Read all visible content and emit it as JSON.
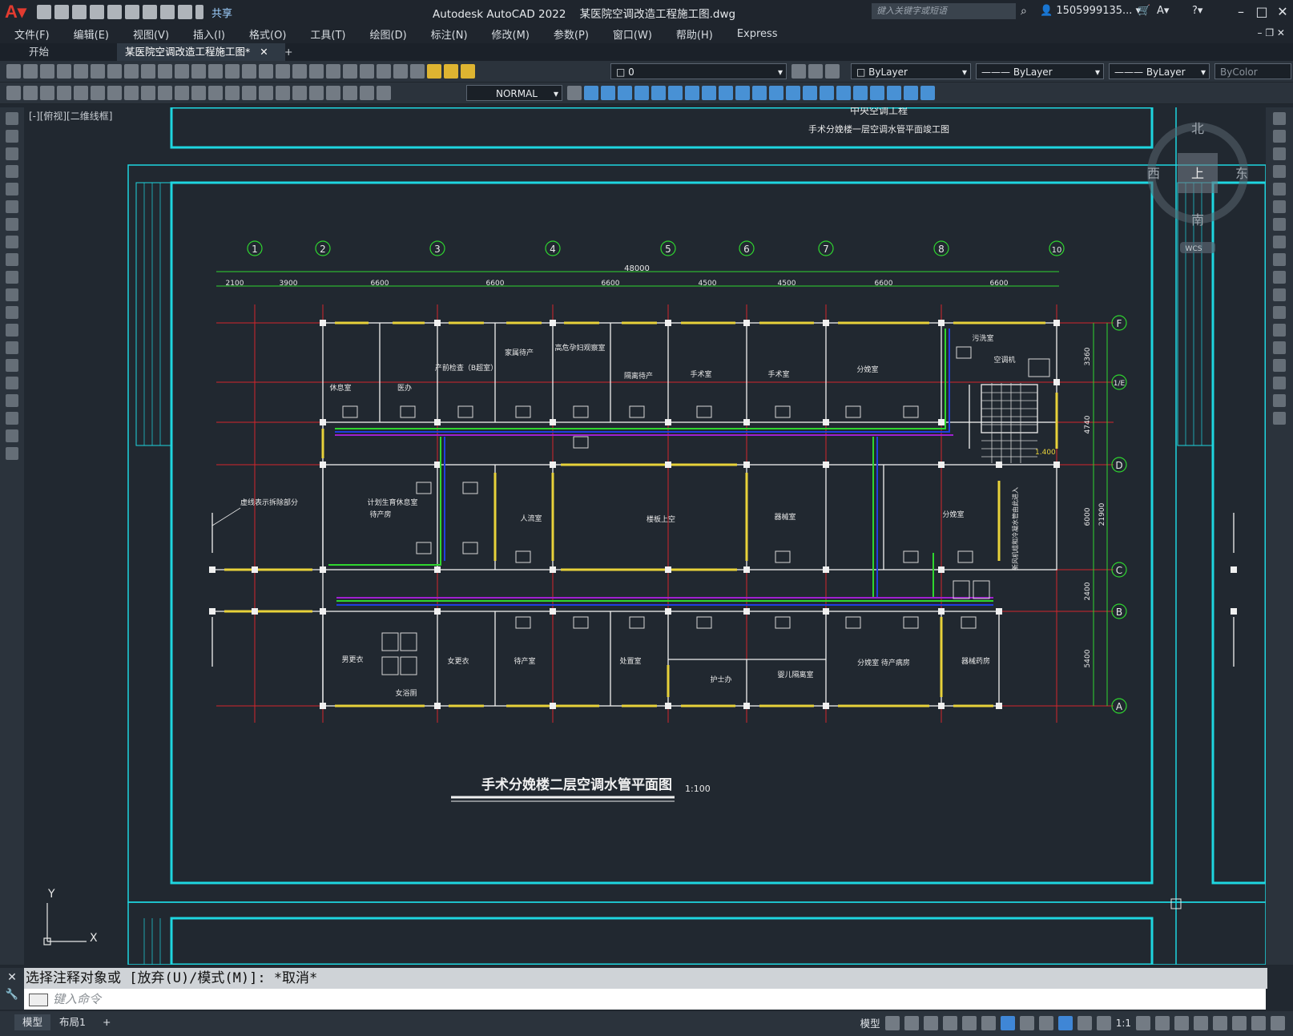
{
  "window": {
    "app_title": "Autodesk AutoCAD 2022",
    "file_name": "某医院空调改造工程施工图.dwg",
    "share_label": "共享",
    "search_placeholder": "键入关键字或短语",
    "user_name": "1505999135..."
  },
  "menu": [
    "文件(F)",
    "编辑(E)",
    "视图(V)",
    "插入(I)",
    "格式(O)",
    "工具(T)",
    "绘图(D)",
    "标注(N)",
    "修改(M)",
    "参数(P)",
    "窗口(W)",
    "帮助(H)",
    "Express"
  ],
  "tabs": {
    "start": "开始",
    "drawing": "某医院空调改造工程施工图*",
    "add": "+"
  },
  "toolbar": {
    "layer": "0",
    "color": "ByLayer",
    "linetype": "ByLayer",
    "lineweight": "ByLayer",
    "plotstyle": "ByColor",
    "textstyle": "NORMAL"
  },
  "viewport": {
    "label": "[-][俯视][二维线框]"
  },
  "viewcube": {
    "north": "北",
    "south": "南",
    "east": "东",
    "west": "西",
    "top": "上",
    "wcs": "WCS"
  },
  "ucs": {
    "x": "X",
    "y": "Y"
  },
  "drawing": {
    "top_title_1": "中央空调工程",
    "top_title_2": "手术分娩楼一层空调水管平面竣工图",
    "main_title": "手术分娩楼二层空调水管平面图",
    "scale": "1:100",
    "total_width": "48000",
    "grid_cols": [
      "1",
      "2",
      "3",
      "4",
      "5",
      "6",
      "7",
      "8",
      "10"
    ],
    "dims": [
      "2100",
      "3900",
      "6600",
      "6600",
      "6600",
      "4500",
      "4500",
      "6600",
      "6600"
    ],
    "grid_rows": [
      "F",
      "1/E",
      "D",
      "C",
      "B",
      "A"
    ],
    "row_dims": [
      "3360",
      "4740",
      "6000",
      "2400",
      "5400"
    ],
    "total_height": "21900",
    "rooms": [
      "休息室",
      "医办",
      "产前检查（B超室）",
      "家属待产",
      "高危孕妇观察室",
      "隔离待产",
      "手术室",
      "手术室",
      "分娩室",
      "污洗室",
      "空调机",
      "计划生育休息室",
      "待产房",
      "人流室",
      "楼板上空",
      "器械室",
      "分娩室",
      "男更衣",
      "女更衣",
      "女浴厕",
      "待产室",
      "处置室",
      "护士办",
      "婴儿隔离室",
      "分娩室 待产病房",
      "器械药房"
    ],
    "left_note": "虚线表示拆除部分",
    "right_note": "新风机组和冷凝水管由此进入",
    "elev": "1.400"
  },
  "command": {
    "history": "选择注释对象或 [放弃(U)/模式(M)]: *取消*",
    "placeholder": "键入命令"
  },
  "status": {
    "model": "模型",
    "layout1": "布局1",
    "add": "+",
    "model_btn": "模型",
    "scale": "1:1"
  }
}
